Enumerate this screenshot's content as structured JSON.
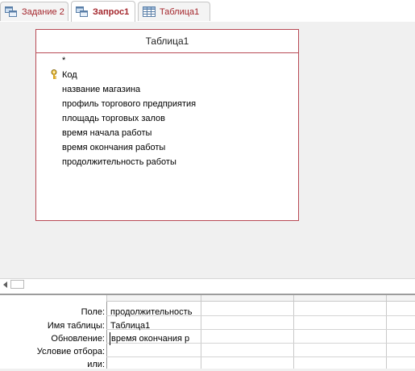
{
  "tabs": [
    {
      "label": "Задание 2",
      "icon": "query-icon",
      "active": false
    },
    {
      "label": "Запрос1",
      "icon": "query-icon",
      "active": true
    },
    {
      "label": "Таблица1",
      "icon": "table-icon",
      "active": false
    }
  ],
  "table_box": {
    "title": "Таблица1",
    "fields": [
      "*",
      "Код",
      "название магазина",
      "профиль торгового предприятия",
      "площадь торговых залов",
      "время начала работы",
      "время окончания работы",
      "продолжительность работы"
    ],
    "primary_key_field": "Код"
  },
  "grid": {
    "row_labels": {
      "field": "Поле:",
      "table": "Имя таблицы:",
      "update": "Обновление:",
      "criteria": "Условие отбора:",
      "or": "или:"
    },
    "column1": {
      "field": "продолжительность",
      "table": "Таблица1",
      "update": "время окончания р"
    }
  },
  "colors": {
    "tab_text": "#a4262c",
    "table_border": "#b84a55"
  }
}
